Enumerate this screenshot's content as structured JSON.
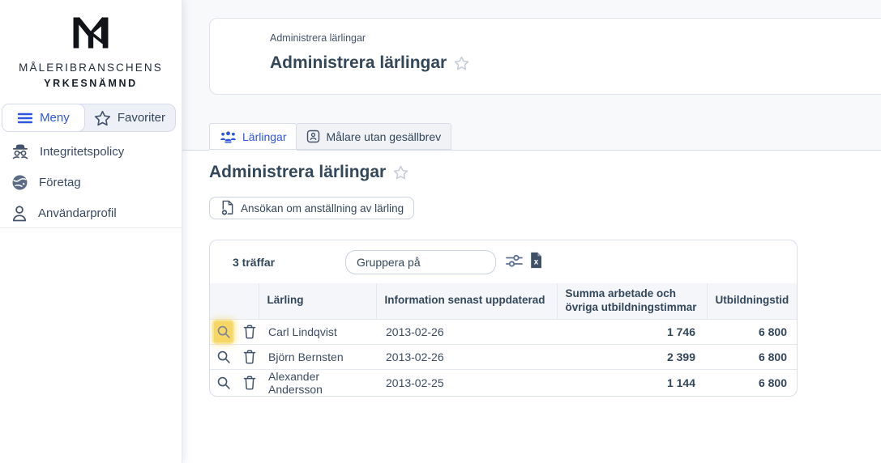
{
  "sidebar": {
    "brand_line1": "MÅLERIBRANSCHENS",
    "brand_line2": "YRKESNÄMND",
    "menu_button": "Meny",
    "favorites_button": "Favoriter",
    "items": [
      {
        "label": "Integritetspolicy",
        "icon": "incognito-icon"
      },
      {
        "label": "Företag",
        "icon": "globe-icon"
      },
      {
        "label": "Användarprofil",
        "icon": "user-icon"
      }
    ]
  },
  "header": {
    "breadcrumb": "Administrera lärlingar",
    "title": "Administrera lärlingar"
  },
  "tabs": [
    {
      "label": "Lärlingar",
      "icon": "users-icon",
      "active": true
    },
    {
      "label": "Målare utan gesällbrev",
      "icon": "badge-icon",
      "active": false
    }
  ],
  "content": {
    "heading": "Administrera lärlingar",
    "new_application_button": "Ansökan om anställning av lärling",
    "results_count": "3 träffar",
    "group_by_placeholder": "Gruppera på",
    "table": {
      "columns": {
        "actions": "",
        "name": "Lärling",
        "updated": "Information senast uppdaterad",
        "hours": "Summa arbetade och övriga utbildningstimmar",
        "training_time": "Utbildningstid"
      },
      "rows": [
        {
          "name": "Carl Lindqvist",
          "updated": "2013-02-26",
          "hours": "1 746",
          "training_time": "6 800"
        },
        {
          "name": "Björn Bernsten",
          "updated": "2013-02-26",
          "hours": "2 399",
          "training_time": "6 800"
        },
        {
          "name": "Alexander Andersson",
          "updated": "2013-02-25",
          "hours": "1 144",
          "training_time": "6 800"
        }
      ]
    }
  },
  "colors": {
    "accent_blue": "#2e55e0",
    "text_slate": "#33475b",
    "highlight_yellow": "#f6d765",
    "border": "#d8dde8",
    "table_header_bg": "#f5f6fa"
  }
}
